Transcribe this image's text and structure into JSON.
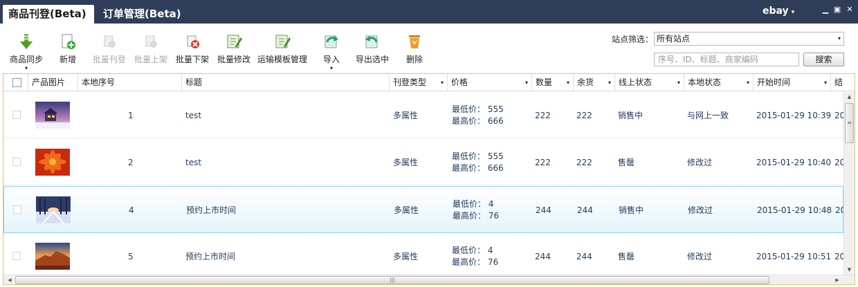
{
  "tabs": [
    {
      "label": "商品刊登(Beta)",
      "active": true
    },
    {
      "label": "订单管理(Beta)",
      "active": false
    }
  ],
  "brand": {
    "label": "ebay",
    "caret": "▾"
  },
  "window_controls": {
    "minimize": "▁",
    "restore": "▣",
    "close": "✕"
  },
  "toolbar": {
    "buttons": [
      {
        "label": "商品同步",
        "icon": "sync-down-arrow-icon",
        "enabled": true,
        "dropdown": "▾"
      },
      {
        "label": "新增",
        "icon": "new-document-icon",
        "enabled": true
      },
      {
        "label": "批量刊登",
        "icon": "batch-publish-icon",
        "enabled": false
      },
      {
        "label": "批量上架",
        "icon": "batch-list-icon",
        "enabled": false
      },
      {
        "label": "批量下架",
        "icon": "batch-delist-icon",
        "enabled": true
      },
      {
        "label": "批量修改",
        "icon": "batch-edit-icon",
        "enabled": true
      },
      {
        "label": "运输模板管理",
        "icon": "shipping-template-icon",
        "enabled": true
      },
      {
        "label": "导入",
        "icon": "import-icon",
        "enabled": true,
        "dropdown": "▾"
      },
      {
        "label": "导出选中",
        "icon": "export-icon",
        "enabled": true
      },
      {
        "label": "删除",
        "icon": "delete-trash-icon",
        "enabled": true
      }
    ]
  },
  "filter": {
    "site_label": "站点筛选：",
    "site_value": "所有站点",
    "search_placeholder": "序号、ID、标题、商家编码",
    "search_button": "搜索"
  },
  "grid": {
    "columns": [
      "产品图片",
      "本地序号",
      "标题",
      "刊登类型",
      "价格",
      "数量",
      "余货",
      "线上状态",
      "本地状态",
      "开始时间",
      "结"
    ],
    "sort_glyph": "▾",
    "price_min_label": "最低价：",
    "price_max_label": "最高价：",
    "rows": [
      {
        "seq": "1",
        "title": "test",
        "type": "多属性",
        "price_min": "555",
        "price_max": "666",
        "qty": "222",
        "stock": "222",
        "online": "销售中",
        "local": "与网上一致",
        "start": "2015-01-29 10:39",
        "end": "20",
        "selected": false,
        "thumb": "winter-house-photo"
      },
      {
        "seq": "2",
        "title": "test",
        "type": "多属性",
        "price_min": "555",
        "price_max": "666",
        "qty": "222",
        "stock": "222",
        "online": "售罄",
        "local": "修改过",
        "start": "2015-01-29 10:40",
        "end": "20",
        "selected": false,
        "thumb": "red-flower-photo"
      },
      {
        "seq": "4",
        "title": "预约上市时间",
        "type": "多属性",
        "price_min": "4",
        "price_max": "76",
        "qty": "244",
        "stock": "244",
        "online": "销售中",
        "local": "修改过",
        "start": "2015-01-29 10:48",
        "end": "20",
        "selected": true,
        "thumb": "snowy-forest-photo"
      },
      {
        "seq": "5",
        "title": "预约上市时间",
        "type": "多属性",
        "price_min": "4",
        "price_max": "76",
        "qty": "244",
        "stock": "244",
        "online": "售罄",
        "local": "修改过",
        "start": "2015-01-29 10:51",
        "end": "20",
        "selected": false,
        "thumb": "desert-rock-photo"
      }
    ]
  },
  "scrollbar": {
    "up": "▲",
    "down": "▼",
    "left": "◀",
    "right": "▶",
    "grip_v": "≡",
    "grip_h": "|||"
  },
  "colors": {
    "titlebar": "#2f3e58",
    "selected_row_border": "#8fd2ee",
    "grid_border": "#e5c76b",
    "cell_text": "#1f3a5a"
  }
}
